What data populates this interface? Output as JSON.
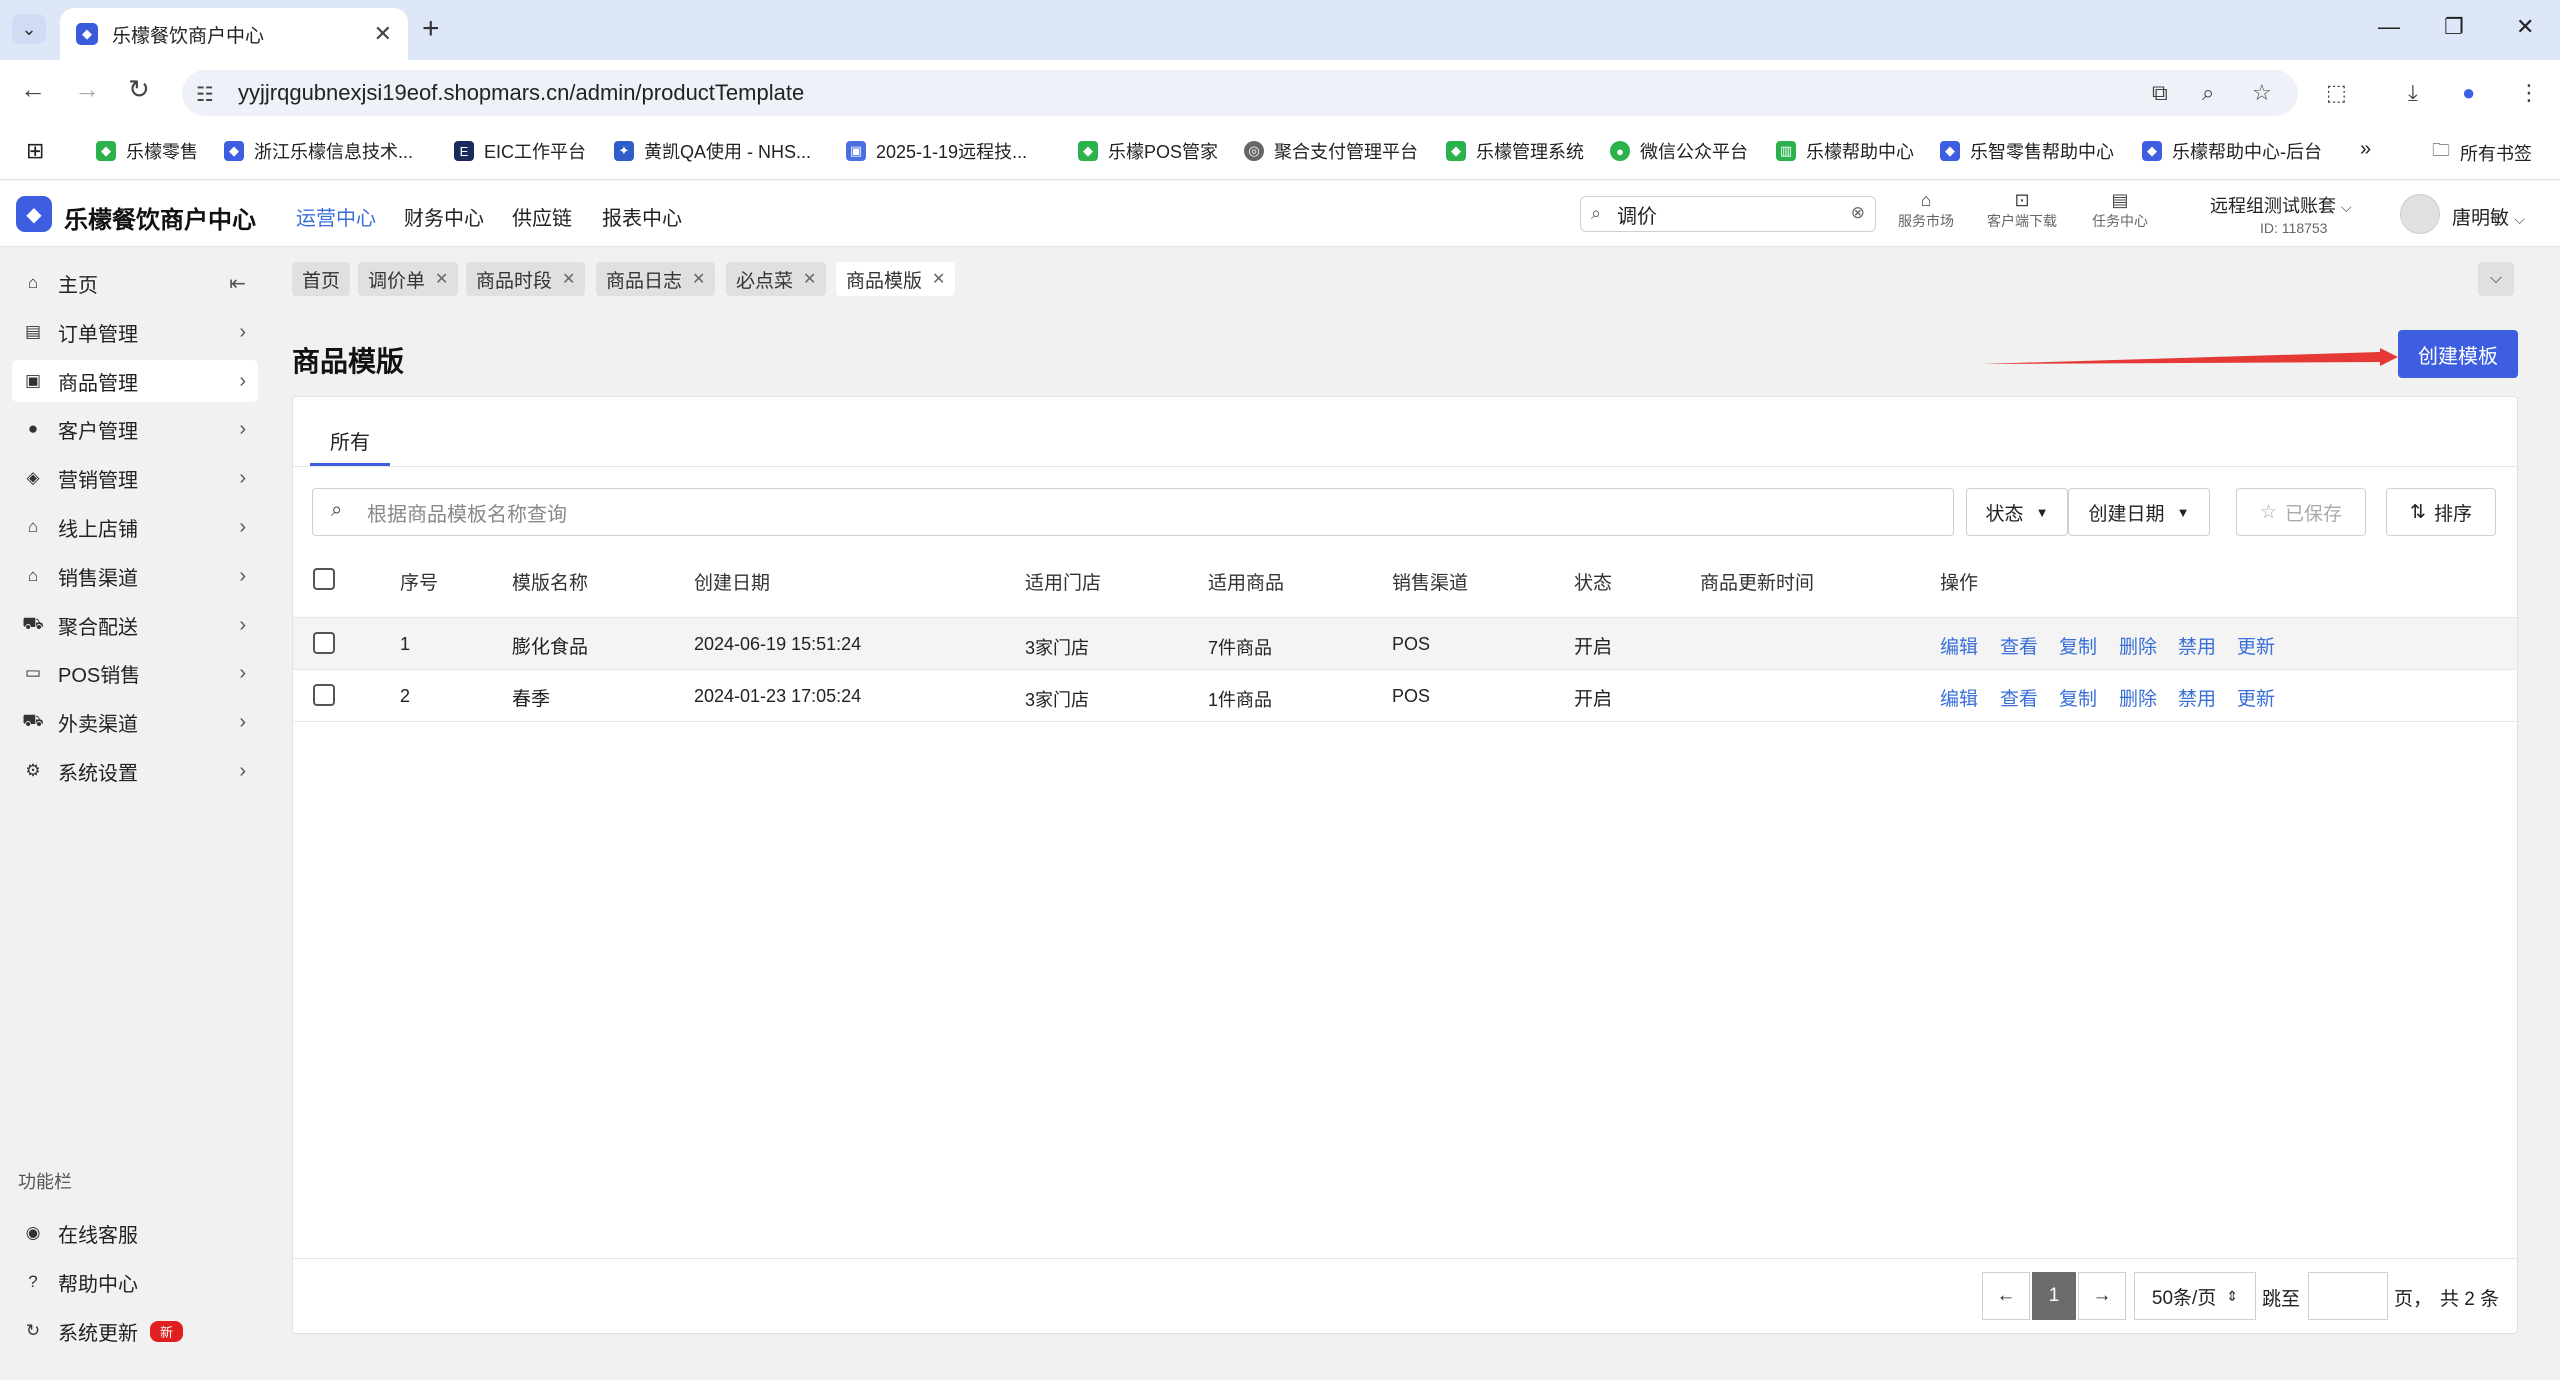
{
  "browser": {
    "tab_title": "乐檬餐饮商户中心",
    "url": "yyjjrqgubnexjsi19eof.shopmars.cn/admin/productTemplate",
    "bookmarks": [
      {
        "label": "乐檬零售",
        "color": "#2bb24c"
      },
      {
        "label": "浙江乐檬信息技术...",
        "color": "#3d5ee0"
      },
      {
        "label": "EIC工作平台",
        "color": "#1a2a5a"
      },
      {
        "label": "黄凯QA使用 - NHS...",
        "color": "#2e5fc9"
      },
      {
        "label": "2025-1-19远程技...",
        "color": "#4a6fe0"
      },
      {
        "label": "乐檬POS管家",
        "color": "#2bb24c"
      },
      {
        "label": "聚合支付管理平台",
        "color": "#666666"
      },
      {
        "label": "乐檬管理系统",
        "color": "#2bb24c"
      },
      {
        "label": "微信公众平台",
        "color": "#2bb24c"
      },
      {
        "label": "乐檬帮助中心",
        "color": "#2bb24c"
      },
      {
        "label": "乐智零售帮助中心",
        "color": "#3d5ee0"
      },
      {
        "label": "乐檬帮助中心-后台",
        "color": "#3d5ee0"
      }
    ],
    "all_bookmarks": "所有书签"
  },
  "header": {
    "brand": "乐檬餐饮商户中心",
    "nav": [
      "运营中心",
      "财务中心",
      "供应链",
      "报表中心"
    ],
    "search_value": "调价",
    "tools": [
      "服务市场",
      "客户端下载",
      "任务中心"
    ],
    "account_name": "远程组测试账套",
    "account_id": "ID: 118753",
    "username": "唐明敏"
  },
  "sidebar": {
    "items": [
      {
        "label": "主页",
        "icon": "home-icon"
      },
      {
        "label": "订单管理",
        "icon": "order-icon"
      },
      {
        "label": "商品管理",
        "icon": "product-icon"
      },
      {
        "label": "客户管理",
        "icon": "user-icon"
      },
      {
        "label": "营销管理",
        "icon": "tag-icon"
      },
      {
        "label": "线上店铺",
        "icon": "store-icon"
      },
      {
        "label": "销售渠道",
        "icon": "bank-icon"
      },
      {
        "label": "聚合配送",
        "icon": "delivery-icon"
      },
      {
        "label": "POS销售",
        "icon": "pos-icon"
      },
      {
        "label": "外卖渠道",
        "icon": "takeout-icon"
      },
      {
        "label": "系统设置",
        "icon": "gear-icon"
      }
    ],
    "section_label": "功能栏",
    "footer_items": [
      {
        "label": "在线客服",
        "icon": "support-icon"
      },
      {
        "label": "帮助中心",
        "icon": "help-icon"
      },
      {
        "label": "系统更新",
        "icon": "refresh-icon",
        "badge": "新"
      }
    ]
  },
  "page_tabs": [
    "首页",
    "调价单",
    "商品时段",
    "商品日志",
    "必点菜",
    "商品模版"
  ],
  "page": {
    "title": "商品模版",
    "create_button": "创建模板",
    "content_tab": "所有",
    "search_placeholder": "根据商品模板名称查询",
    "filters": {
      "status": "状态",
      "created_date": "创建日期",
      "saved": "已保存",
      "sort": "排序"
    }
  },
  "table": {
    "columns": [
      "序号",
      "模版名称",
      "创建日期",
      "适用门店",
      "适用商品",
      "销售渠道",
      "状态",
      "商品更新时间",
      "操作"
    ],
    "actions": [
      "编辑",
      "查看",
      "复制",
      "删除",
      "禁用",
      "更新"
    ],
    "rows": [
      {
        "index": "1",
        "name": "膨化食品",
        "created": "2024-06-19 15:51:24",
        "stores": "3家门店",
        "products": "7件商品",
        "channel": "POS",
        "status": "开启",
        "updated": ""
      },
      {
        "index": "2",
        "name": "春季",
        "created": "2024-01-23 17:05:24",
        "stores": "3家门店",
        "products": "1件商品",
        "channel": "POS",
        "status": "开启",
        "updated": ""
      }
    ]
  },
  "pagination": {
    "current_page": "1",
    "page_size": "50条/页",
    "jump_label": "跳至",
    "page_suffix": "页，",
    "total": "共 2 条"
  },
  "colors": {
    "accent": "#3d5ee0",
    "link": "#3a6fd8",
    "arrow": "#e53935"
  }
}
